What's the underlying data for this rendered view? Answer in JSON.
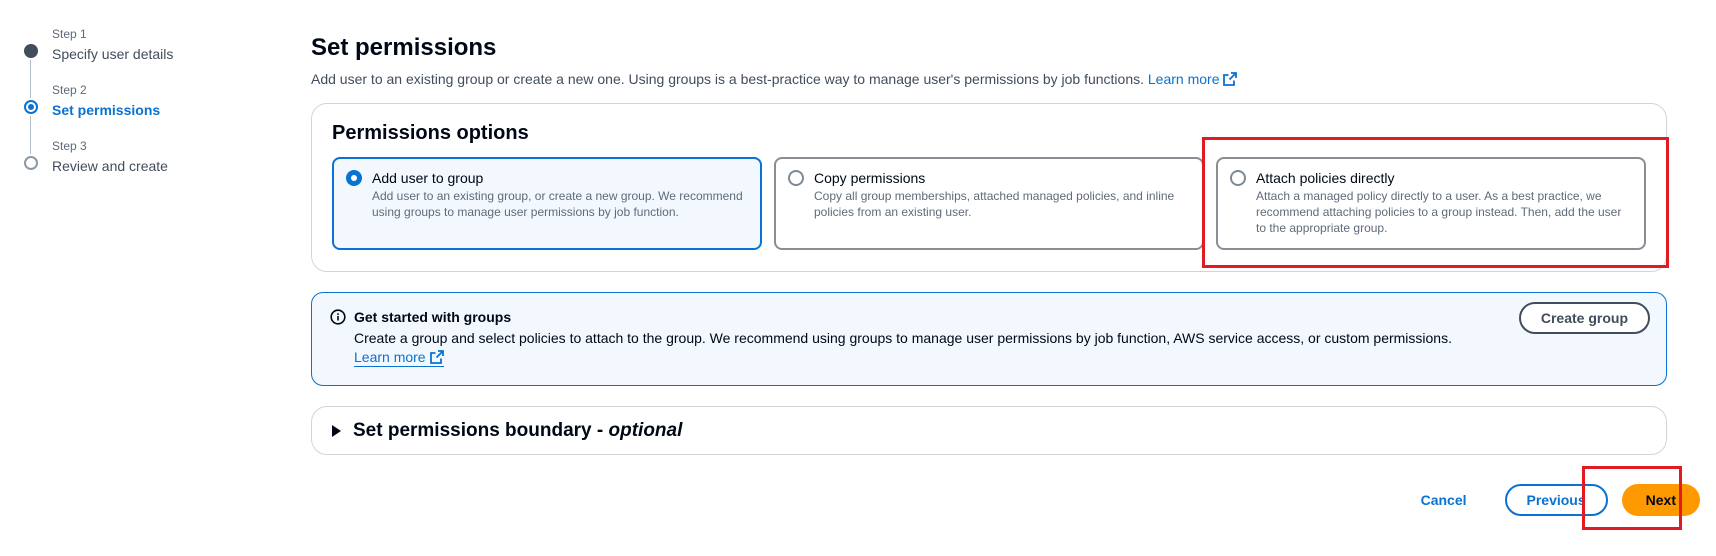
{
  "wizard": {
    "steps": [
      {
        "sublabel": "Step 1",
        "label": "Specify user details",
        "state": "done"
      },
      {
        "sublabel": "Step 2",
        "label": "Set permissions",
        "state": "current"
      },
      {
        "sublabel": "Step 3",
        "label": "Review and create",
        "state": "pending"
      }
    ]
  },
  "header": {
    "title": "Set permissions",
    "description": "Add user to an existing group or create a new one. Using groups is a best-practice way to manage user's permissions by job functions.",
    "learn_more": "Learn more"
  },
  "permissions_options": {
    "title": "Permissions options",
    "options": [
      {
        "title": "Add user to group",
        "description": "Add user to an existing group, or create a new group. We recommend using groups to manage user permissions by job function.",
        "selected": true
      },
      {
        "title": "Copy permissions",
        "description": "Copy all group memberships, attached managed policies, and inline policies from an existing user.",
        "selected": false
      },
      {
        "title": "Attach policies directly",
        "description": "Attach a managed policy directly to a user. As a best practice, we recommend attaching policies to a group instead. Then, add the user to the appropriate group.",
        "selected": false
      }
    ]
  },
  "info_alert": {
    "title": "Get started with groups",
    "text": "Create a group and select policies to attach to the group. We recommend using groups to manage user permissions by job function, AWS service access, or custom permissions.",
    "learn_more": "Learn more",
    "button": "Create group"
  },
  "boundary": {
    "title": "Set permissions boundary - ",
    "optional": "optional"
  },
  "footer": {
    "cancel": "Cancel",
    "previous": "Previous",
    "next": "Next"
  },
  "colors": {
    "accent": "#0972d3",
    "primary_button": "#ff9900",
    "highlight": "#e01b24"
  }
}
